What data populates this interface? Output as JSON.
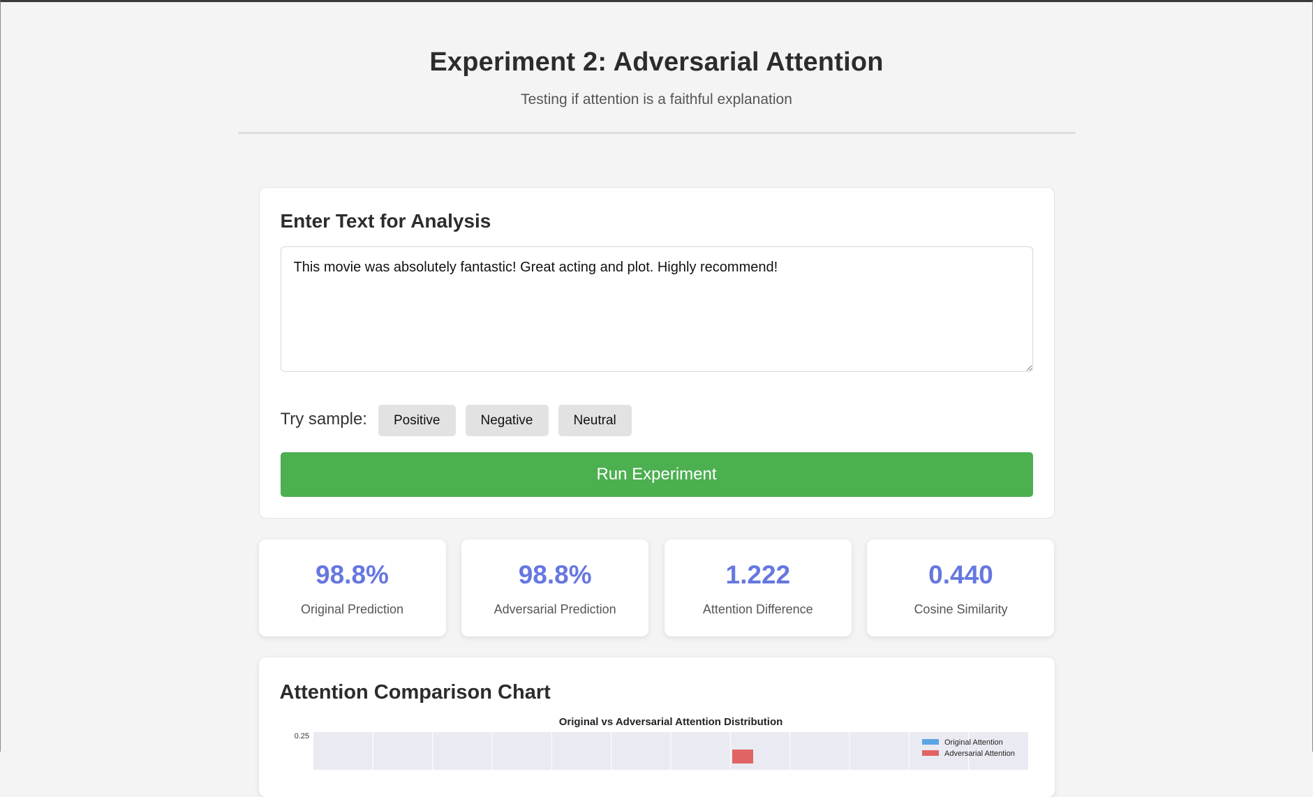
{
  "header": {
    "title": "Experiment 2: Adversarial Attention",
    "subtitle": "Testing if attention is a faithful explanation"
  },
  "input_card": {
    "heading": "Enter Text for Analysis",
    "text_value": "This movie was absolutely fantastic! Great acting and plot. Highly recommend!",
    "samples_label": "Try sample:",
    "samples": [
      "Positive",
      "Negative",
      "Neutral"
    ],
    "run_label": "Run Experiment"
  },
  "stats": [
    {
      "value": "98.8%",
      "label": "Original Prediction"
    },
    {
      "value": "98.8%",
      "label": "Adversarial Prediction"
    },
    {
      "value": "1.222",
      "label": "Attention Difference"
    },
    {
      "value": "0.440",
      "label": "Cosine Similarity"
    }
  ],
  "chart_card": {
    "heading": "Attention Comparison Chart"
  },
  "chart_data": {
    "type": "bar",
    "title": "Original vs Adversarial Attention Distribution",
    "y_tick_visible": "0.25",
    "legend_position": "top-right",
    "grid": true,
    "series": [
      {
        "name": "Original Attention",
        "color": "#5aa5e6"
      },
      {
        "name": "Adversarial Attention",
        "color": "#e06464"
      }
    ],
    "colors": {
      "plot_background": "#eaeaf2",
      "grid": "#ffffff"
    }
  }
}
